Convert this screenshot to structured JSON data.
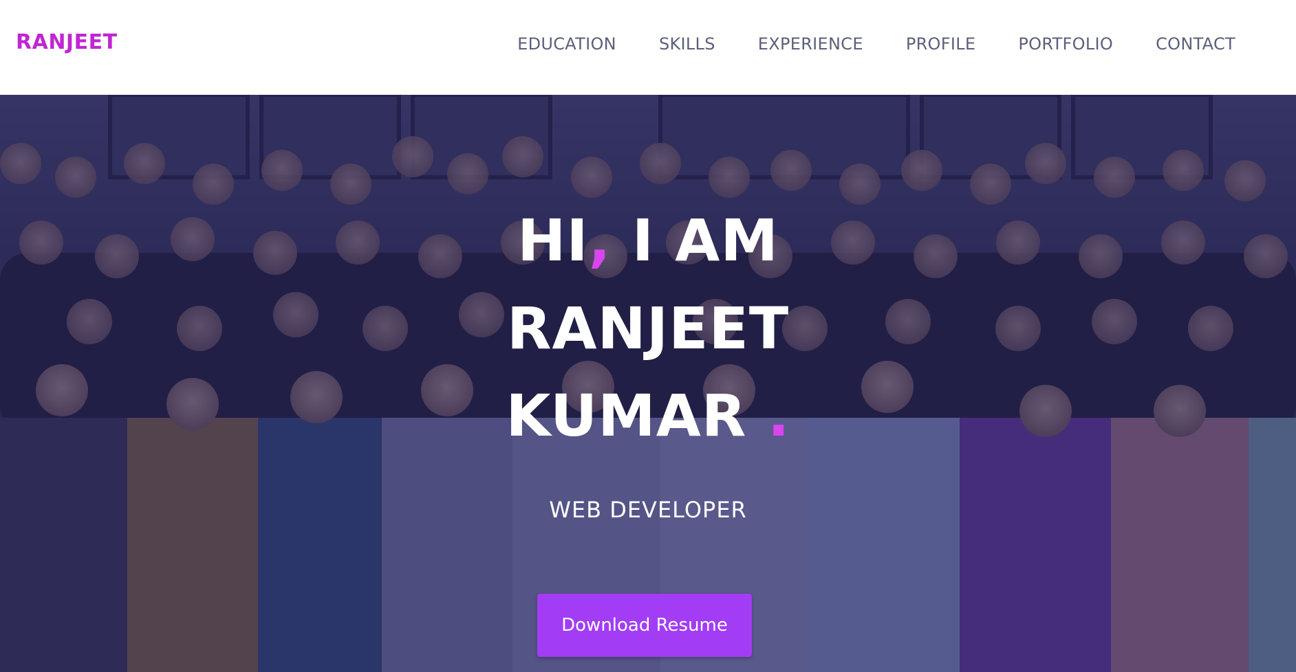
{
  "colors": {
    "brand": "#c026d3",
    "nav_text": "#5b5f7a",
    "accent": "#d946ef",
    "button_bg": "#a23cf5",
    "overlay": "#26225c"
  },
  "navbar": {
    "brand": "RANJEET",
    "links": [
      {
        "label": "EDUCATION"
      },
      {
        "label": "SKILLS"
      },
      {
        "label": "EXPERIENCE"
      },
      {
        "label": "PROFILE"
      },
      {
        "label": "PORTFOLIO"
      },
      {
        "label": "CONTACT"
      }
    ]
  },
  "hero": {
    "background_image": "group-photo",
    "line1_a": "HI",
    "line1_comma": ",",
    "line1_b": " I AM",
    "line2": "RANJEET",
    "line3": "KUMAR ",
    "line3_dot": ".",
    "subtitle": "WEB DEVELOPER",
    "cta_label": "Download Resume"
  }
}
